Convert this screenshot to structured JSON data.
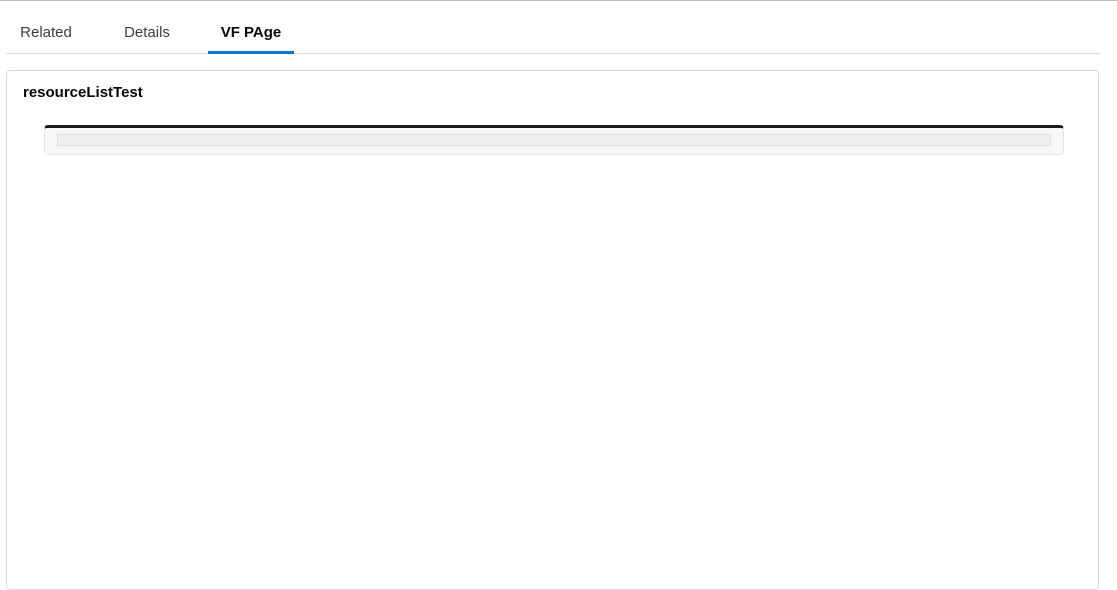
{
  "tabs": [
    {
      "label": "Related",
      "active": false
    },
    {
      "label": "Details",
      "active": false
    },
    {
      "label": "VF PAge",
      "active": true
    }
  ],
  "panel": {
    "title": "resourceListTest"
  },
  "colors": {
    "active_tab_underline": "#0176d3",
    "frame_top_border": "#1c1c1c"
  }
}
